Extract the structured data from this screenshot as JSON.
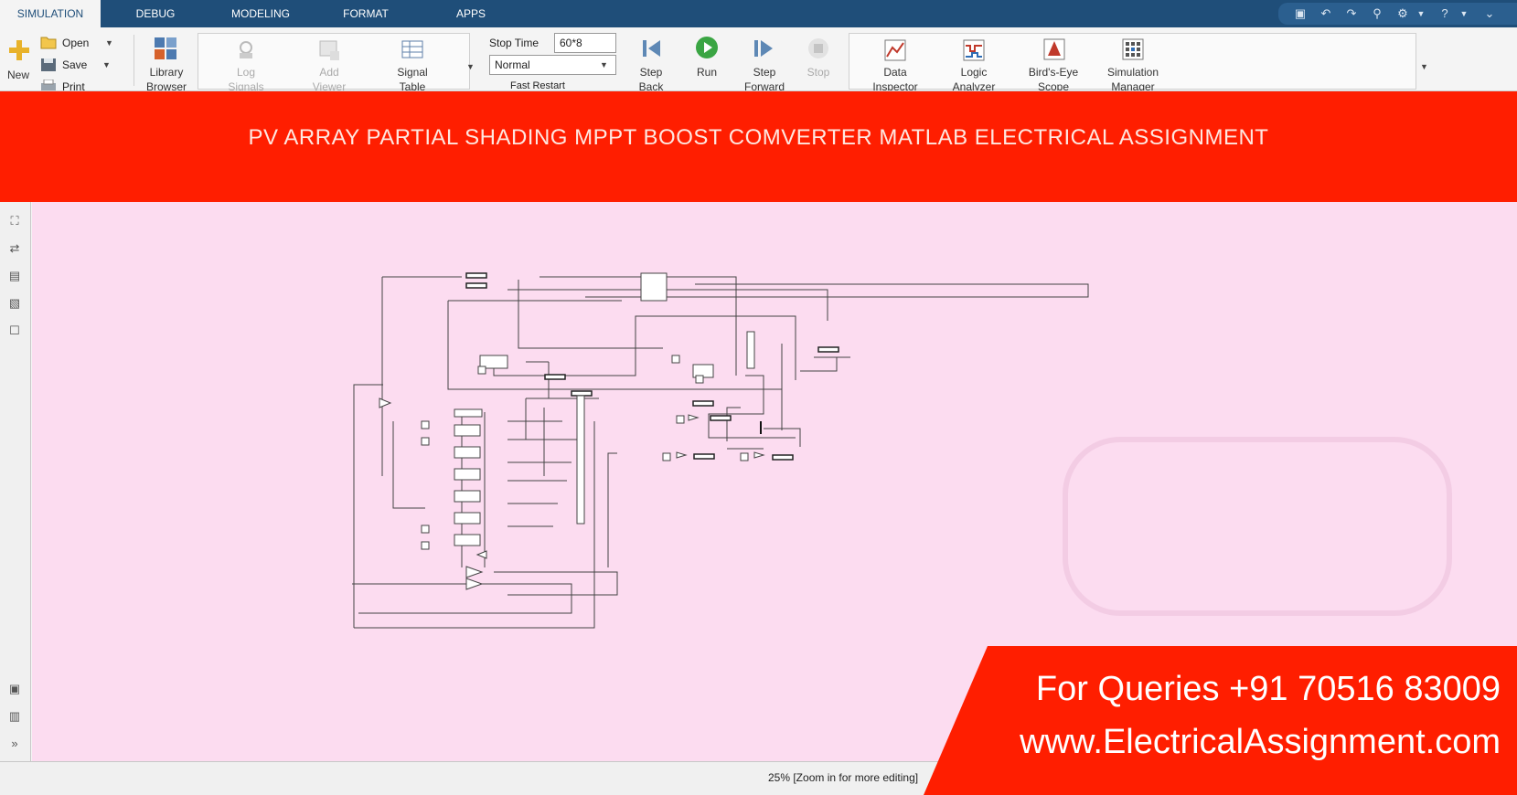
{
  "tabs": [
    {
      "label": "SIMULATION",
      "active": true
    },
    {
      "label": "DEBUG",
      "active": false
    },
    {
      "label": "MODELING",
      "active": false
    },
    {
      "label": "FORMAT",
      "active": false
    },
    {
      "label": "APPS",
      "active": false
    }
  ],
  "ribbon": {
    "file": {
      "new": "New",
      "open": "Open",
      "save": "Save",
      "print": "Print"
    },
    "library": {
      "label": "Library",
      "label2": "Browser"
    },
    "prepare": {
      "log_signals": "Log",
      "log_signals2": "Signals",
      "add_viewer": "Add",
      "add_viewer2": "Viewer",
      "signal_table": "Signal",
      "signal_table2": "Table"
    },
    "simulate": {
      "stop_time_label": "Stop Time",
      "stop_time_value": "60*8",
      "mode_value": "Normal",
      "fast_restart": "Fast Restart",
      "step_back": "Step",
      "step_back2": "Back",
      "run": "Run",
      "step_forward": "Step",
      "step_forward2": "Forward",
      "stop": "Stop"
    },
    "review": {
      "data_inspector": "Data",
      "data_inspector2": "Inspector",
      "logic_analyzer": "Logic",
      "logic_analyzer2": "Analyzer",
      "birds_eye": "Bird's-Eye",
      "birds_eye2": "Scope",
      "sim_manager": "Simulation",
      "sim_manager2": "Manager"
    }
  },
  "banner": {
    "title": "PV ARRAY PARTIAL SHADING MPPT BOOST COMVERTER MATLAB ELECTRICAL ASSIGNMENT"
  },
  "status": {
    "zoom_text": "25% [Zoom in for more editing]"
  },
  "promo": {
    "line1": "For Queries +91 70516 83009",
    "line2": "www.ElectricalAssignment.com"
  },
  "colors": {
    "tabbar": "#1f4e79",
    "banner": "#ff1e00",
    "canvas": "#fcdcf0",
    "promo": "#ff1e00"
  },
  "icons": {
    "new": "plus-icon",
    "open": "folder-icon",
    "save": "disk-icon",
    "print": "printer-icon",
    "library": "library-grid-icon",
    "run": "play-icon",
    "step_back": "step-back-icon",
    "step_forward": "step-forward-icon",
    "stop": "stop-icon"
  }
}
